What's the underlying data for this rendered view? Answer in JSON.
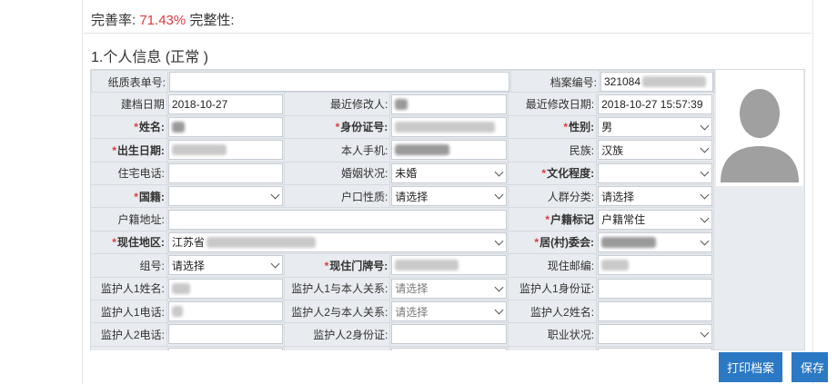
{
  "header": {
    "rate_label": "完善率:",
    "rate_value": "71.43%",
    "completeness_label": "完整性:"
  },
  "section": {
    "title": "1.个人信息 (正常 )"
  },
  "form": {
    "paper_no_label": "纸质表单号:",
    "paper_no_value": "",
    "archive_no_label": "档案编号:",
    "archive_no_value": "321084",
    "create_date_label": "建档日期",
    "create_date_value": "2018-10-27",
    "last_modifier_label": "最近修改人:",
    "last_modified_date_label": "最近修改日期:",
    "last_modified_date_value": "2018-10-27 15:57:39",
    "name_label": "姓名:",
    "id_card_label": "身份证号:",
    "gender_label": "性别:",
    "gender_value": "男",
    "birth_label": "出生日期:",
    "phone_label": "本人手机:",
    "ethnicity_label": "民族:",
    "ethnicity_value": "汉族",
    "home_phone_label": "住宅电话:",
    "marital_label": "婚姻状况:",
    "marital_value": "未婚",
    "education_label": "文化程度:",
    "education_value": "",
    "nationality_label": "国籍:",
    "nationality_value": "",
    "hukou_nature_label": "户口性质:",
    "hukou_nature_value": "请选择",
    "population_label": "人群分类:",
    "population_value": "请选择",
    "hukou_addr_label": "户籍地址:",
    "hukou_mark_label": "户籍标记",
    "hukou_mark_value": "户籍常住",
    "current_area_label": "现住地区:",
    "current_area_value": "江苏省",
    "committee_label": "居(村)委会:",
    "group_label": "组号:",
    "group_value": "请选择",
    "door_no_label": "现住门牌号:",
    "postcode_label": "现住邮编:",
    "guardian1_name_label": "监护人1姓名:",
    "guardian1_relation_label": "监护人1与本人关系:",
    "guardian1_relation_value": "请选择",
    "guardian1_id_label": "监护人1身份证:",
    "guardian1_phone_label": "监护人1电话:",
    "guardian2_relation_label": "监护人2与本人关系:",
    "guardian2_relation_value": "请选择",
    "guardian2_name_label": "监护人2姓名:",
    "guardian2_phone_label": "监护人2电话:",
    "guardian2_id_label": "监护人2身份证:",
    "occupation_label": "职业状况:",
    "occupation_value": ""
  },
  "buttons": {
    "print": "打印档案",
    "save": "保存"
  },
  "colors": {
    "rate": "#e0393e",
    "button": "#2b78c5",
    "form_bg": "#e8ebef"
  }
}
